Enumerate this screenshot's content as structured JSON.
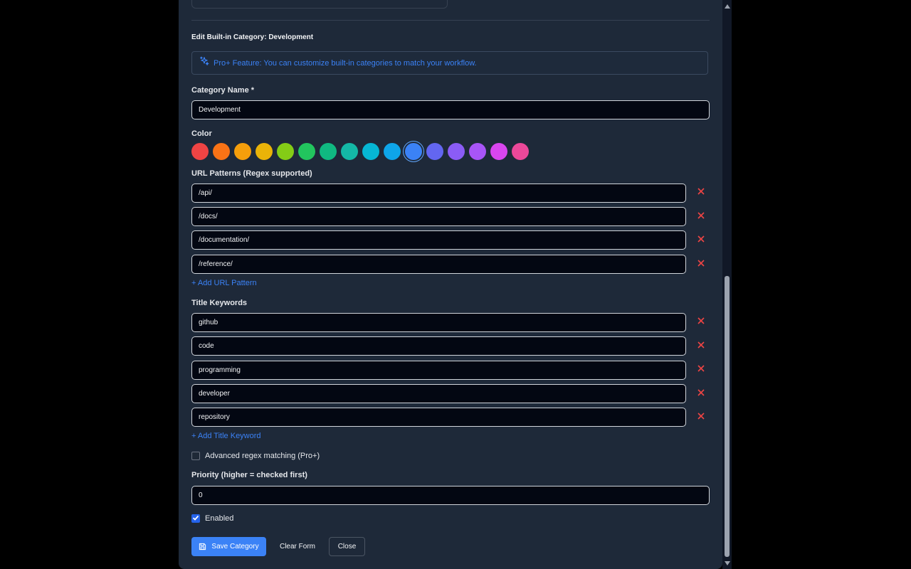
{
  "form": {
    "title": "Edit Built-in Category: Development",
    "pro_notice": "Pro+ Feature: You can customize built-in categories to match your workflow.",
    "name_label": "Category Name *",
    "name_value": "Development",
    "color_label": "Color",
    "colors": [
      "#ef4444",
      "#f97316",
      "#f59e0b",
      "#eab308",
      "#84cc16",
      "#22c55e",
      "#10b981",
      "#14b8a6",
      "#06b6d4",
      "#0ea5e9",
      "#3b82f6",
      "#6366f1",
      "#8b5cf6",
      "#a855f7",
      "#d946ef",
      "#ec4899"
    ],
    "selected_color": "#3b82f6",
    "url_label": "URL Patterns (Regex supported)",
    "url_patterns": [
      "/api/",
      "/docs/",
      "/documentation/",
      "/reference/"
    ],
    "add_url_label": "+ Add URL Pattern",
    "keywords_label": "Title Keywords",
    "keywords": [
      "github",
      "code",
      "programming",
      "developer",
      "repository"
    ],
    "add_keyword_label": "+ Add Title Keyword",
    "advanced_label": "Advanced regex matching (Pro+)",
    "advanced_checked": false,
    "priority_label": "Priority (higher = checked first)",
    "priority_value": "0",
    "enabled_label": "Enabled",
    "enabled_checked": true
  },
  "buttons": {
    "save": "Save Category",
    "clear": "Clear Form",
    "close": "Close"
  },
  "icons": {
    "pro": "sparkles-icon",
    "remove": "close-icon",
    "save": "floppy-disk-icon",
    "check": "check-icon"
  },
  "accent_color": "#3b82f6",
  "remove_color": "#ef4444"
}
